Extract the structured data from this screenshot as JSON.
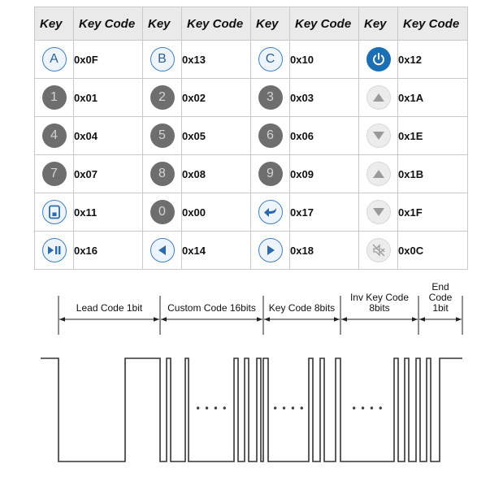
{
  "table": {
    "headers": [
      {
        "key": "Key",
        "code": "Key Code"
      },
      {
        "key": "Key",
        "code": "Key Code"
      },
      {
        "key": "Key",
        "code": "Key Code"
      },
      {
        "key": "Key",
        "code": "Key Code"
      }
    ],
    "rows": [
      [
        {
          "icon": "letter-a-icon",
          "glyph": "A",
          "style": "letter",
          "code": "0x0F"
        },
        {
          "icon": "letter-b-icon",
          "glyph": "B",
          "style": "letter",
          "code": "0x13"
        },
        {
          "icon": "letter-c-icon",
          "glyph": "C",
          "style": "letter",
          "code": "0x10"
        },
        {
          "icon": "power-icon",
          "glyph": "",
          "style": "power",
          "code": "0x12"
        }
      ],
      [
        {
          "icon": "digit-1-icon",
          "glyph": "1",
          "style": "digit",
          "code": "0x01"
        },
        {
          "icon": "digit-2-icon",
          "glyph": "2",
          "style": "digit",
          "code": "0x02"
        },
        {
          "icon": "digit-3-icon",
          "glyph": "3",
          "style": "digit",
          "code": "0x03"
        },
        {
          "icon": "volume-up-icon",
          "glyph": "",
          "style": "grey",
          "code": "0x1A"
        }
      ],
      [
        {
          "icon": "digit-4-icon",
          "glyph": "4",
          "style": "digit",
          "code": "0x04"
        },
        {
          "icon": "digit-5-icon",
          "glyph": "5",
          "style": "digit",
          "code": "0x05"
        },
        {
          "icon": "digit-6-icon",
          "glyph": "6",
          "style": "digit",
          "code": "0x06"
        },
        {
          "icon": "volume-down-icon",
          "glyph": "",
          "style": "grey",
          "code": "0x1E"
        }
      ],
      [
        {
          "icon": "digit-7-icon",
          "glyph": "7",
          "style": "digit",
          "code": "0x07"
        },
        {
          "icon": "digit-8-icon",
          "glyph": "8",
          "style": "digit",
          "code": "0x08"
        },
        {
          "icon": "digit-9-icon",
          "glyph": "9",
          "style": "digit",
          "code": "0x09"
        },
        {
          "icon": "channel-up-icon",
          "glyph": "",
          "style": "grey",
          "code": "0x1B"
        }
      ],
      [
        {
          "icon": "menu-icon",
          "glyph": "",
          "style": "blue",
          "code": "0x11"
        },
        {
          "icon": "digit-0-icon",
          "glyph": "0",
          "style": "digit",
          "code": "0x00"
        },
        {
          "icon": "return-icon",
          "glyph": "",
          "style": "blue",
          "code": "0x17"
        },
        {
          "icon": "channel-down-icon",
          "glyph": "",
          "style": "grey",
          "code": "0x1F"
        }
      ],
      [
        {
          "icon": "play-pause-icon",
          "glyph": "",
          "style": "blue",
          "code": "0x16"
        },
        {
          "icon": "left-arrow-icon",
          "glyph": "",
          "style": "blue",
          "code": "0x14"
        },
        {
          "icon": "right-arrow-icon",
          "glyph": "",
          "style": "blue",
          "code": "0x18"
        },
        {
          "icon": "mute-icon",
          "glyph": "",
          "style": "grey",
          "code": "0x0C"
        }
      ]
    ]
  },
  "timing": {
    "segments": [
      {
        "label_lines": [
          "Lead Code 1bit"
        ]
      },
      {
        "label_lines": [
          "Custom Code 16bits"
        ]
      },
      {
        "label_lines": [
          "Key Code 8bits"
        ]
      },
      {
        "label_lines": [
          "Inv Key Code",
          "8bits"
        ]
      },
      {
        "label_lines": [
          "End",
          "Code",
          "1bit"
        ]
      }
    ],
    "ellipsis": "• • • •"
  }
}
